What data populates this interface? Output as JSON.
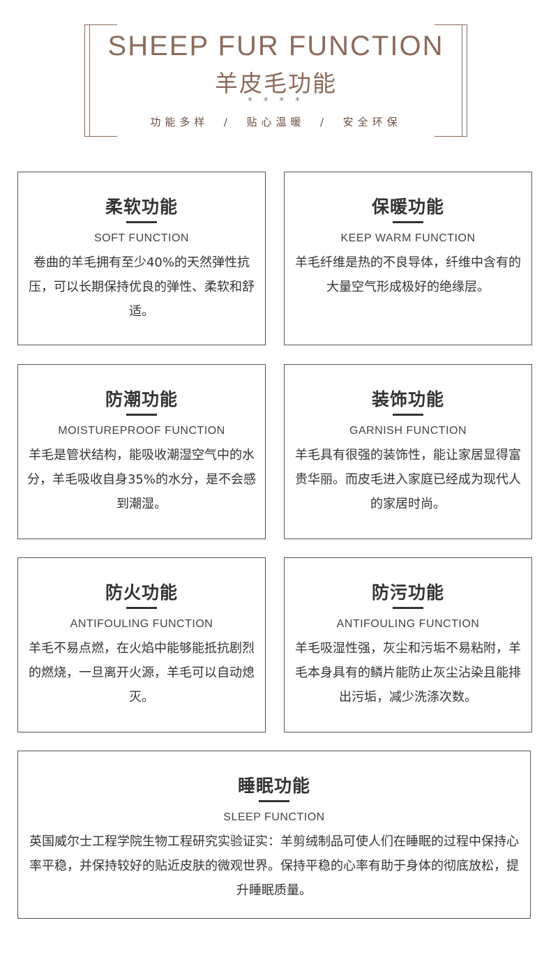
{
  "header": {
    "title_en": "SHEEP FUR FUNCTION",
    "title_cn": "羊皮毛功能",
    "stars": "* * * *",
    "tagline": "功能多样  /  贴心温暖  /  安全环保"
  },
  "cards": [
    {
      "title": "柔软功能",
      "subtitle": "SOFT FUNCTION",
      "desc": "卷曲的羊毛拥有至少40%的天然弹性抗压，可以长期保持优良的弹性、柔软和舒适。"
    },
    {
      "title": "保暖功能",
      "subtitle": "KEEP WARM FUNCTION",
      "desc": "羊毛纤维是热的不良导体，纤维中含有的大量空气形成极好的绝缘层。"
    },
    {
      "title": "防潮功能",
      "subtitle": "MOISTUREPROOF FUNCTION",
      "desc": "羊毛是管状结构，能吸收潮湿空气中的水分，羊毛吸收自身35%的水分，是不会感到潮湿。"
    },
    {
      "title": "装饰功能",
      "subtitle": "GARNISH FUNCTION",
      "desc": "羊毛具有很强的装饰性，能让家居显得富贵华丽。而皮毛进入家庭已经成为现代人的家居时尚。"
    },
    {
      "title": "防火功能",
      "subtitle": "ANTIFOULING FUNCTION",
      "desc": "羊毛不易点燃，在火焰中能够能抵抗剧烈的燃烧，一旦离开火源，羊毛可以自动熄灭。"
    },
    {
      "title": "防污功能",
      "subtitle": "ANTIFOULING FUNCTION",
      "desc": "羊毛吸湿性强，灰尘和污垢不易粘附，羊毛本身具有的鳞片能防止灰尘沾染且能排出污垢，减少洗涤次数。"
    },
    {
      "title": "睡眠功能",
      "subtitle": "SLEEP FUNCTION",
      "desc": "英国威尔士工程学院生物工程研究实验证实：羊剪绒制品可使人们在睡眠的过程中保持心率平稳，并保持较好的贴近皮肤的微观世界。保持平稳的心率有助于身体的彻底放松，提升睡眠质量。"
    }
  ]
}
